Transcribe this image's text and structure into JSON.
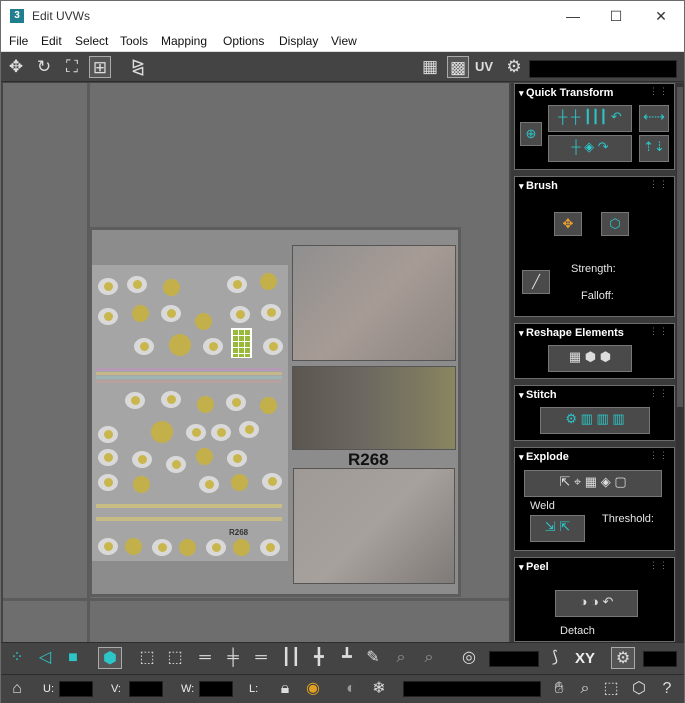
{
  "window": {
    "title": "Edit UVWs",
    "app_icon": "3"
  },
  "window_controls": {
    "minimize": "—",
    "maximize": "☐",
    "close": "✕"
  },
  "menu": [
    "File",
    "Edit",
    "Select",
    "Tools",
    "Mapping",
    "Options",
    "Display",
    "View"
  ],
  "toolbar": {
    "uv_label": "UV"
  },
  "texture": {
    "code": "R268",
    "sticker_label": "R268"
  },
  "panels": {
    "quick_transform": {
      "title": "Quick Transform"
    },
    "brush": {
      "title": "Brush",
      "strength_label": "Strength:",
      "falloff_label": "Falloff:"
    },
    "reshape": {
      "title": "Reshape Elements"
    },
    "stitch": {
      "title": "Stitch"
    },
    "explode": {
      "title": "Explode",
      "weld_label": "Weld",
      "threshold_label": "Threshold:"
    },
    "peel": {
      "title": "Peel",
      "detach_label": "Detach"
    }
  },
  "bottom": {
    "xy_label": "XY",
    "u_label": "U:",
    "v_label": "V:",
    "w_label": "W:",
    "l_label": "L:"
  },
  "colors": {
    "accent": "#2cc6c8",
    "panel_bg": "#000000",
    "ui_bg": "#444444",
    "viewport_bg": "#6e6e6e"
  }
}
